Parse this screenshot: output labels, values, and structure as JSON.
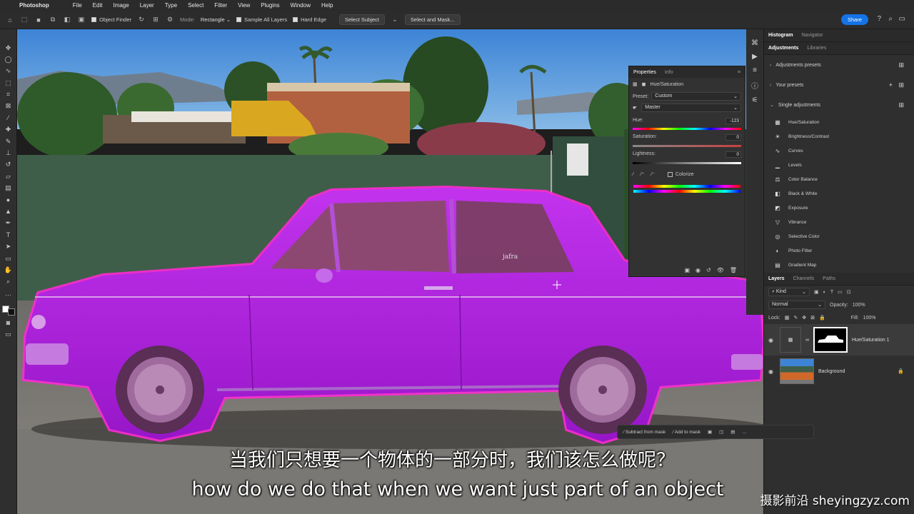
{
  "menubar": {
    "app": "Photoshop",
    "items": [
      "File",
      "Edit",
      "Image",
      "Layer",
      "Type",
      "Select",
      "Filter",
      "View",
      "Plugins",
      "Window",
      "Help"
    ]
  },
  "options": {
    "object_finder": "Object Finder",
    "mode_label": "Mode:",
    "mode_value": "Rectangle",
    "sample_all_layers": "Sample All Layers",
    "hard_edge": "Hard Edge",
    "select_subject": "Select Subject",
    "select_and_mask": "Select and Mask...",
    "share": "Share"
  },
  "properties": {
    "tabs": [
      "Properties",
      "Info"
    ],
    "adjustment_name": "Hue/Saturation",
    "preset_label": "Preset:",
    "preset_value": "Custom",
    "channel": "Master",
    "hue_label": "Hue:",
    "hue_value": "-123",
    "saturation_label": "Saturation:",
    "saturation_value": "0",
    "lightness_label": "Lightness:",
    "lightness_value": "0",
    "colorize": "Colorize"
  },
  "right": {
    "top_tabs": [
      "Histogram",
      "Navigator"
    ],
    "adj_tabs": [
      "Adjustments",
      "Libraries"
    ],
    "adjustments_presets": "Adjustments presets",
    "your_presets": "Your presets",
    "single_adjustments": "Single adjustments",
    "adjustments": [
      {
        "label": "Hue/Saturation",
        "icon": "hue-saturation-icon"
      },
      {
        "label": "Brightness/Contrast",
        "icon": "brightness-icon"
      },
      {
        "label": "Curves",
        "icon": "curves-icon"
      },
      {
        "label": "Levels",
        "icon": "levels-icon"
      },
      {
        "label": "Color Balance",
        "icon": "color-balance-icon"
      },
      {
        "label": "Black & White",
        "icon": "black-white-icon"
      },
      {
        "label": "Exposure",
        "icon": "exposure-icon"
      },
      {
        "label": "Vibrance",
        "icon": "vibrance-icon"
      },
      {
        "label": "Selective Color",
        "icon": "selective-color-icon"
      },
      {
        "label": "Photo Filter",
        "icon": "photo-filter-icon"
      },
      {
        "label": "Gradient Map",
        "icon": "gradient-map-icon"
      }
    ],
    "layers_tabs": [
      "Layers",
      "Channels",
      "Paths"
    ],
    "kind": "Kind",
    "blend_mode": "Normal",
    "opacity_label": "Opacity:",
    "opacity_value": "100%",
    "lock_label": "Lock:",
    "fill_label": "Fill:",
    "fill_value": "100%",
    "layers": [
      {
        "name": "Hue/Saturation 1"
      },
      {
        "name": "Background"
      }
    ]
  },
  "taskbar": {
    "subtract": "Subtract from mask",
    "add": "Add to mask"
  },
  "canvas": {
    "sign_text": "jafra"
  },
  "subtitles": {
    "cn": "当我们只想要一个物体的一部分时，我们该怎么做呢？",
    "en": "how do we do that when we want just part of an object",
    "watermark": "摄影前沿 sheyingzyz.com"
  },
  "colors": {
    "accent": "#1473e6",
    "car": "#b21ee0",
    "mask_outline": "#ff2ad4"
  }
}
